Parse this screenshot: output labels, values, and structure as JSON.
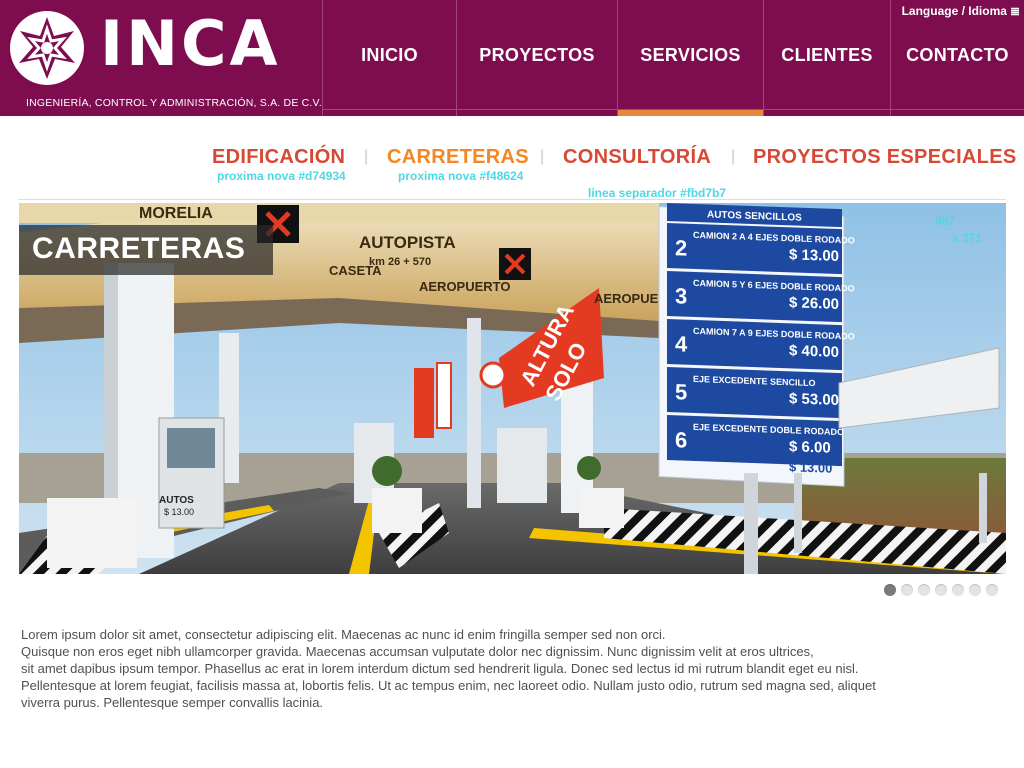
{
  "header": {
    "logo_text": "INCA",
    "logo_subtitle": "INGENIERÍA, CONTROL Y ADMINISTRACIÓN, S.A. DE C.V.",
    "language_label": "Language / Idioma",
    "nav": [
      {
        "label": "INICIO"
      },
      {
        "label": "PROYECTOS"
      },
      {
        "label": "SERVICIOS",
        "active": true
      },
      {
        "label": "CLIENTES"
      },
      {
        "label": "CONTACTO"
      }
    ]
  },
  "subnav": {
    "items": [
      {
        "label": "EDIFICACIÓN",
        "color": "#d74934"
      },
      {
        "label": "CARRETERAS",
        "color": "#f48624",
        "active": true
      },
      {
        "label": "CONSULTORÍA",
        "color": "#d74934"
      },
      {
        "label": "PROYECTOS ESPECIALES",
        "color": "#d74934"
      }
    ],
    "separator": "|",
    "notes": {
      "edificacion": "proxima nova #d74934",
      "carreteras": "proxima nova #f48624",
      "separator_line": "linea separador #fbd7b7"
    }
  },
  "hero": {
    "title": "CARRETERAS",
    "dimension_width": "987",
    "dimension_height": "x 371",
    "signs": {
      "autopista": "AUTOPISTA",
      "km": "km 26 + 570",
      "caseta": "CASETA",
      "aeropuerto": "AEROPUERTO",
      "morelia": "MORELIA",
      "altura": "ALTURA",
      "solo": "SOLO",
      "autos": "AUTOS",
      "autos_price": "$ 13.00",
      "toll_rows": [
        {
          "num": "2",
          "text": "CAMION 2 A 4 EJES DOBLE RODADO",
          "price": "$ 13.00"
        },
        {
          "num": "3",
          "text": "CAMION 5 Y 6 EJES DOBLE RODADO",
          "price": "$ 26.00"
        },
        {
          "num": "4",
          "text": "CAMION 7 A 9 EJES DOBLE RODADO",
          "price": "$ 40.00"
        },
        {
          "num": "5",
          "text": "EJE EXCEDENTE SENCILLO",
          "price": "$ 53.00"
        },
        {
          "num": "6",
          "text": "EJE EXCEDENTE DOBLE RODADO",
          "price": "$ 6.00"
        }
      ],
      "toll_last_price": "$ 13.00",
      "toll_top": "AUTOS SENCILLOS"
    }
  },
  "slider": {
    "count": 7,
    "active_index": 0
  },
  "body": {
    "paragraph": "Lorem ipsum dolor sit amet, consectetur adipiscing elit. Maecenas ac nunc id enim fringilla semper sed non orci.\nQuisque non eros eget nibh ullamcorper gravida. Maecenas accumsan vulputate dolor nec dignissim. Nunc dignissim velit at eros ultrices,\nsit amet dapibus ipsum tempor. Phasellus ac erat in lorem interdum dictum sed hendrerit ligula. Donec sed lectus id mi rutrum blandit eget eu nisl.\nPellentesque at lorem feugiat, facilisis massa at, lobortis felis. Ut ac tempus enim, nec laoreet odio. Nullam justo odio, rutrum sed magna sed, aliquet\nviverra purus. Pellentesque semper convallis lacinia."
  },
  "colors": {
    "header_bg": "#7d0d4e",
    "nav_active_bar": "#e58a3a",
    "subnav_red": "#d74934",
    "subnav_orange": "#f48624",
    "separator_line": "#fbd7b7",
    "note_cyan": "#4ed8e6"
  }
}
